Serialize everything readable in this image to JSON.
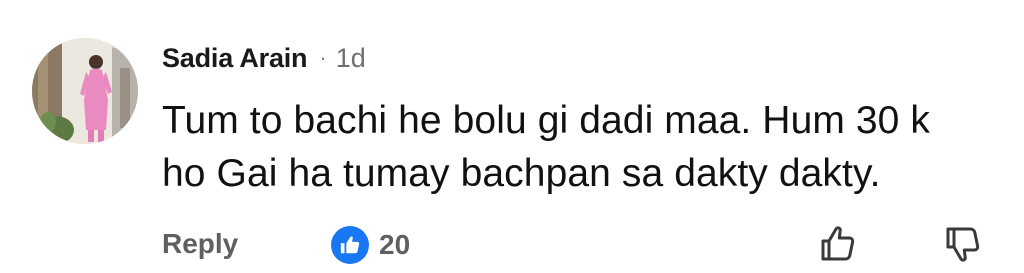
{
  "comment": {
    "author": "Sadia Arain",
    "separator": "·",
    "age": "1d",
    "text_lines": [
      "Tum to bachi he bolu gi dadi maa. Hum 30 k",
      "ho Gai ha tumay bachpan sa dakty dakty."
    ],
    "reply_label": "Reply",
    "reaction_count": "20",
    "reaction_icon": "thumbs-up-icon",
    "like_icon": "thumbs-up-outline-icon",
    "dislike_icon": "thumbs-down-outline-icon",
    "colors": {
      "reaction_badge": "#1877f2",
      "muted_text": "#5f5f5f",
      "body_text": "#111111"
    }
  }
}
